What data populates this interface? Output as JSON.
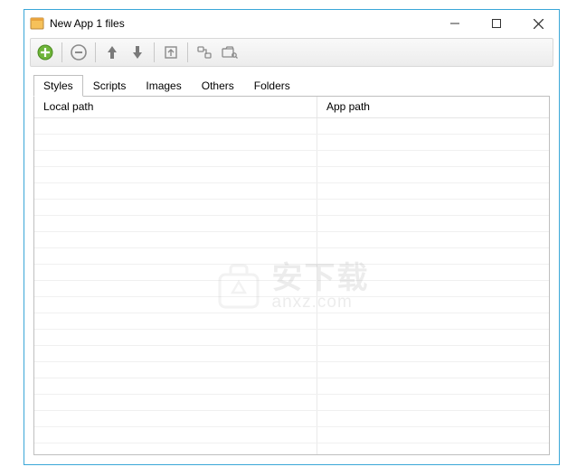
{
  "window": {
    "title": "New App 1 files"
  },
  "tabs": [
    {
      "label": "Styles",
      "active": true
    },
    {
      "label": "Scripts",
      "active": false
    },
    {
      "label": "Images",
      "active": false
    },
    {
      "label": "Others",
      "active": false
    },
    {
      "label": "Folders",
      "active": false
    }
  ],
  "columns": {
    "local": "Local path",
    "app": "App path"
  },
  "toolbar_icons": [
    "add-icon",
    "remove-icon",
    "move-up-icon",
    "move-down-icon",
    "open-icon",
    "link-icon",
    "browse-icon"
  ],
  "watermark": {
    "cn": "安下载",
    "en": "anxz.com"
  }
}
